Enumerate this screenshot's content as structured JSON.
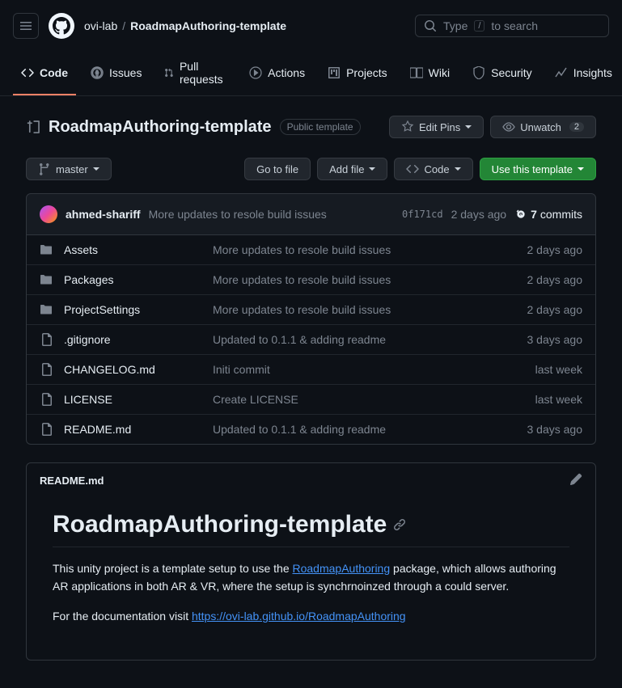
{
  "breadcrumb": {
    "owner": "ovi-lab",
    "repo": "RoadmapAuthoring-template"
  },
  "search": {
    "prefix": "Type",
    "key": "/",
    "suffix": "to search"
  },
  "nav": {
    "code": "Code",
    "issues": "Issues",
    "pulls": "Pull requests",
    "actions": "Actions",
    "projects": "Projects",
    "wiki": "Wiki",
    "security": "Security",
    "insights": "Insights"
  },
  "repo": {
    "name": "RoadmapAuthoring-template",
    "badge": "Public template",
    "editPins": "Edit Pins",
    "unwatch": "Unwatch",
    "unwatchCount": "2"
  },
  "toolbar": {
    "branch": "master",
    "goToFile": "Go to file",
    "addFile": "Add file",
    "code": "Code",
    "useTemplate": "Use this template"
  },
  "latestCommit": {
    "author": "ahmed-shariff",
    "message": "More updates to resole build issues",
    "sha": "0f171cd",
    "ago": "2 days ago",
    "commitsCount": "7",
    "commitsLabel": "commits"
  },
  "files": [
    {
      "type": "dir",
      "name": "Assets",
      "msg": "More updates to resole build issues",
      "time": "2 days ago"
    },
    {
      "type": "dir",
      "name": "Packages",
      "msg": "More updates to resole build issues",
      "time": "2 days ago"
    },
    {
      "type": "dir",
      "name": "ProjectSettings",
      "msg": "More updates to resole build issues",
      "time": "2 days ago"
    },
    {
      "type": "file",
      "name": ".gitignore",
      "msg": "Updated to 0.1.1 & adding readme",
      "time": "3 days ago"
    },
    {
      "type": "file",
      "name": "CHANGELOG.md",
      "msg": "Initi commit",
      "time": "last week"
    },
    {
      "type": "file",
      "name": "LICENSE",
      "msg": "Create LICENSE",
      "time": "last week"
    },
    {
      "type": "file",
      "name": "README.md",
      "msg": "Updated to 0.1.1 & adding readme",
      "time": "3 days ago"
    }
  ],
  "readme": {
    "filename": "README.md",
    "title": "RoadmapAuthoring-template",
    "p1_a": "This unity project is a template setup to use the ",
    "p1_link": "RoadmapAuthoring",
    "p1_b": " package, which allows authoring AR applications in both AR & VR, where the setup is synchrnoinzed through a could server.",
    "p2_a": "For the documentation visit ",
    "p2_link": "https://ovi-lab.github.io/RoadmapAuthoring"
  }
}
